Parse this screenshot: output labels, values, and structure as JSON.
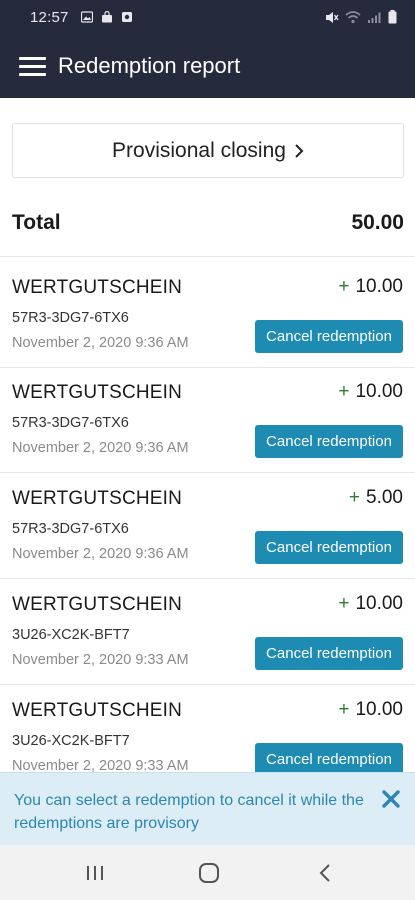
{
  "status_bar": {
    "time": "12:57"
  },
  "header": {
    "title": "Redemption report"
  },
  "provisional": {
    "label": "Provisional closing"
  },
  "total": {
    "label": "Total",
    "value": "50.00"
  },
  "redemptions": [
    {
      "name": "WERTGUTSCHEIN",
      "sign": "+",
      "amount": "10.00",
      "code": "57R3-3DG7-6TX6",
      "date": "November 2, 2020 9:36 AM",
      "action": "Cancel redemption"
    },
    {
      "name": "WERTGUTSCHEIN",
      "sign": "+",
      "amount": "10.00",
      "code": "57R3-3DG7-6TX6",
      "date": "November 2, 2020 9:36 AM",
      "action": "Cancel redemption"
    },
    {
      "name": "WERTGUTSCHEIN",
      "sign": "+",
      "amount": "5.00",
      "code": "57R3-3DG7-6TX6",
      "date": "November 2, 2020 9:36 AM",
      "action": "Cancel redemption"
    },
    {
      "name": "WERTGUTSCHEIN",
      "sign": "+",
      "amount": "10.00",
      "code": "3U26-XC2K-BFT7",
      "date": "November 2, 2020 9:33 AM",
      "action": "Cancel redemption"
    },
    {
      "name": "WERTGUTSCHEIN",
      "sign": "+",
      "amount": "10.00",
      "code": "3U26-XC2K-BFT7",
      "date": "November 2, 2020 9:33 AM",
      "action": "Cancel redemption"
    }
  ],
  "toast": {
    "message": "You can select a redemption to cancel it while the redemptions are provisory"
  },
  "colors": {
    "app_bar": "#262a3d",
    "accent": "#1d8bb2",
    "positive": "#2e7d32",
    "toast_bg": "#dcedf6",
    "toast_text": "#2c86b3"
  }
}
